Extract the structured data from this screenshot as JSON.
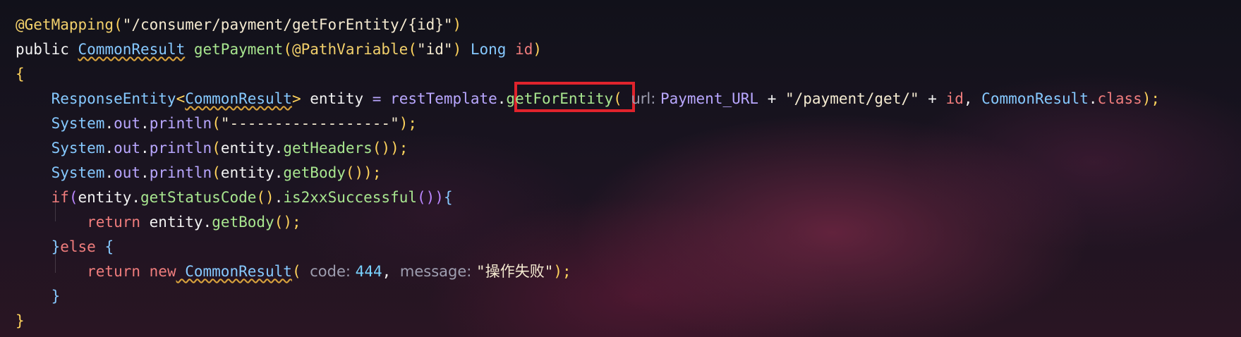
{
  "editor": {
    "lines": [
      {
        "tokens": [
          {
            "text": "@GetMapping",
            "cls": "ann"
          },
          {
            "text": "(",
            "cls": "punc"
          },
          {
            "text": "\"/consumer/payment/getForEntity/{id}\"",
            "cls": "str"
          },
          {
            "text": ")",
            "cls": "punc"
          }
        ]
      },
      {
        "tokens": [
          {
            "text": "public ",
            "cls": "plain"
          },
          {
            "text": "CommonResult",
            "cls": "typeU"
          },
          {
            "text": " getPayment",
            "cls": "method"
          },
          {
            "text": "(",
            "cls": "punc"
          },
          {
            "text": "@PathVariable",
            "cls": "ann"
          },
          {
            "text": "(",
            "cls": "punc"
          },
          {
            "text": "\"id\"",
            "cls": "str"
          },
          {
            "text": ") ",
            "cls": "punc"
          },
          {
            "text": "Long",
            "cls": "type"
          },
          {
            "text": " id",
            "cls": "kw"
          },
          {
            "text": ")",
            "cls": "punc"
          }
        ]
      },
      {
        "tokens": [
          {
            "text": "{",
            "cls": "punc"
          }
        ]
      },
      {
        "tokens": [
          {
            "text": "    ResponseEntity",
            "cls": "type"
          },
          {
            "text": "<",
            "cls": "punc"
          },
          {
            "text": "CommonResult",
            "cls": "typeU"
          },
          {
            "text": "> ",
            "cls": "punc"
          },
          {
            "text": "entity",
            "cls": "plain"
          },
          {
            "text": " = ",
            "cls": "field"
          },
          {
            "text": "restTemplate",
            "cls": "field"
          },
          {
            "text": ".",
            "cls": "plain"
          },
          {
            "text": "getForEntity",
            "cls": "method"
          },
          {
            "text": "( ",
            "cls": "punc"
          },
          {
            "text": "url: ",
            "cls": "hint"
          },
          {
            "text": "Payment_URL",
            "cls": "field"
          },
          {
            "text": " + ",
            "cls": "plain"
          },
          {
            "text": "\"/payment/get/\"",
            "cls": "str"
          },
          {
            "text": " + ",
            "cls": "plain"
          },
          {
            "text": "id",
            "cls": "kw"
          },
          {
            "text": ", ",
            "cls": "plain"
          },
          {
            "text": "CommonResult",
            "cls": "type"
          },
          {
            "text": ".",
            "cls": "plain"
          },
          {
            "text": "class",
            "cls": "kw"
          },
          {
            "text": ");",
            "cls": "punc"
          }
        ]
      },
      {
        "tokens": [
          {
            "text": "    System",
            "cls": "type"
          },
          {
            "text": ".",
            "cls": "plain"
          },
          {
            "text": "out",
            "cls": "field"
          },
          {
            "text": ".",
            "cls": "plain"
          },
          {
            "text": "println",
            "cls": "field"
          },
          {
            "text": "(",
            "cls": "punc"
          },
          {
            "text": "\"------------------\"",
            "cls": "str"
          },
          {
            "text": ");",
            "cls": "punc"
          }
        ]
      },
      {
        "tokens": [
          {
            "text": "    System",
            "cls": "type"
          },
          {
            "text": ".",
            "cls": "plain"
          },
          {
            "text": "out",
            "cls": "field"
          },
          {
            "text": ".",
            "cls": "plain"
          },
          {
            "text": "println",
            "cls": "field"
          },
          {
            "text": "(",
            "cls": "punc"
          },
          {
            "text": "entity",
            "cls": "plain"
          },
          {
            "text": ".",
            "cls": "plain"
          },
          {
            "text": "getHeaders",
            "cls": "method"
          },
          {
            "text": "());",
            "cls": "punc"
          }
        ]
      },
      {
        "tokens": [
          {
            "text": "    System",
            "cls": "type"
          },
          {
            "text": ".",
            "cls": "plain"
          },
          {
            "text": "out",
            "cls": "field"
          },
          {
            "text": ".",
            "cls": "plain"
          },
          {
            "text": "println",
            "cls": "field"
          },
          {
            "text": "(",
            "cls": "punc"
          },
          {
            "text": "entity",
            "cls": "plain"
          },
          {
            "text": ".",
            "cls": "plain"
          },
          {
            "text": "getBody",
            "cls": "method"
          },
          {
            "text": "());",
            "cls": "punc"
          }
        ]
      },
      {
        "tokens": [
          {
            "text": "    if",
            "cls": "kw"
          },
          {
            "text": "(",
            "cls": "punc2"
          },
          {
            "text": "entity",
            "cls": "plain"
          },
          {
            "text": ".",
            "cls": "plain"
          },
          {
            "text": "getStatusCode",
            "cls": "method"
          },
          {
            "text": "()",
            "cls": "punc"
          },
          {
            "text": ".",
            "cls": "plain"
          },
          {
            "text": "is2xxSuccessful",
            "cls": "method"
          },
          {
            "text": "())",
            "cls": "punc2"
          },
          {
            "text": "{",
            "cls": "type"
          }
        ]
      },
      {
        "tokens": [
          {
            "text": "        return",
            "cls": "kw"
          },
          {
            "text": " entity",
            "cls": "plain"
          },
          {
            "text": ".",
            "cls": "plain"
          },
          {
            "text": "getBody",
            "cls": "method"
          },
          {
            "text": "();",
            "cls": "punc"
          }
        ]
      },
      {
        "tokens": [
          {
            "text": "    }",
            "cls": "type"
          },
          {
            "text": "else",
            "cls": "kw"
          },
          {
            "text": " {",
            "cls": "type"
          }
        ]
      },
      {
        "tokens": [
          {
            "text": "        return",
            "cls": "kw"
          },
          {
            "text": " new",
            "cls": "kw"
          },
          {
            "text": " CommonResult",
            "cls": "typeU"
          },
          {
            "text": "( ",
            "cls": "punc"
          },
          {
            "text": "code: ",
            "cls": "hint"
          },
          {
            "text": "444",
            "cls": "num"
          },
          {
            "text": ", ",
            "cls": "plain"
          },
          {
            "text": "message: ",
            "cls": "hint"
          },
          {
            "text": "\"操作失败\"",
            "cls": "str"
          },
          {
            "text": ");",
            "cls": "punc"
          }
        ]
      },
      {
        "tokens": [
          {
            "text": "    }",
            "cls": "type"
          }
        ]
      },
      {
        "tokens": [
          {
            "text": "}",
            "cls": "punc"
          }
        ]
      }
    ]
  }
}
